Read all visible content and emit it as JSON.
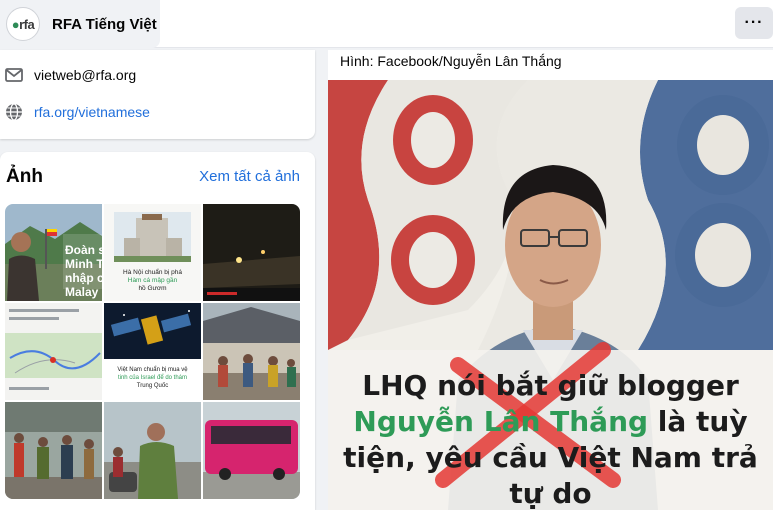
{
  "header": {
    "logo_text": "rfa",
    "page_name": "RFA Tiếng Việt",
    "more_label": "···"
  },
  "intro": {
    "email": "vietweb@rfa.org",
    "website": "rfa.org/vietnamese"
  },
  "photos": {
    "title": "Ảnh",
    "see_all": "Xem tất cả ảnh",
    "tiles": [
      {
        "caption_lines": [
          "Đoàn s",
          "Minh T",
          "nhập c",
          "Malay"
        ]
      },
      {
        "caption_lines": [
          "Hà Nội chuẩn bị phá",
          "Hàm cá mập gần",
          "hồ Gươm"
        ]
      },
      {
        "caption_lines": []
      },
      {
        "caption_lines": []
      },
      {
        "caption_lines": [
          "Việt Nam chuẩn bị mua vệ",
          "tinh của Israel để do thám",
          "Trung Quốc"
        ]
      },
      {
        "caption_lines": []
      },
      {
        "caption_lines": []
      },
      {
        "caption_lines": []
      },
      {
        "caption_lines": []
      }
    ]
  },
  "post": {
    "caption": "Hình: Facebook/Nguyễn Lân Thắng",
    "headline": {
      "line1": "LHQ nói bắt giữ blogger",
      "line2_green": "Nguyễn Lân Thắng",
      "line2_rest": " là tuỳ",
      "line3": "tiện, yêu cầu Việt Nam trả",
      "line4": "tự do"
    }
  },
  "colors": {
    "link": "#216fdb",
    "accent_green": "#2e9b57",
    "cross_red": "#e53935"
  }
}
